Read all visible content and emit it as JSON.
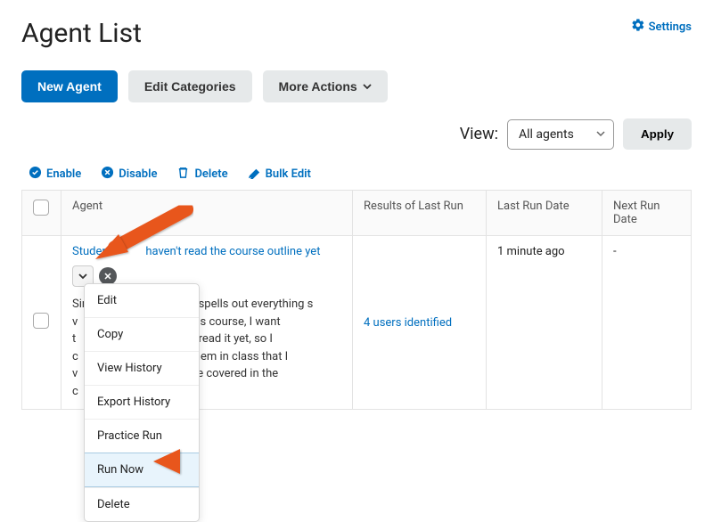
{
  "pageTitle": "Agent List",
  "settingsLabel": "Settings",
  "toolbar": {
    "newAgent": "New Agent",
    "editCategories": "Edit Categories",
    "moreActions": "More Actions"
  },
  "view": {
    "label": "View:",
    "selected": "All agents",
    "apply": "Apply"
  },
  "bulkActions": {
    "enable": "Enable",
    "disable": "Disable",
    "delete": "Delete",
    "bulkEdit": "Bulk Edit"
  },
  "columns": {
    "agent": "Agent",
    "results": "Results of Last Run",
    "lastRun": "Last Run Date",
    "nextRun": "Next Run Date"
  },
  "rows": [
    {
      "titlePart1": "Student",
      "titlePart2": "haven't read the course outline yet",
      "descPart1": "Since the course outline spells out everything s",
      "descPart2a": "ut this course, I want",
      "descPart2b": "t",
      "descPart3a": "ven't read it yet, so I",
      "descPart3b": "c",
      "descPart4a": "nd them in class that I",
      "descPart4b": "v",
      "descPart5a": "at are covered in the",
      "descPart5b": "c",
      "results": "4 users identified",
      "lastRun": "1 minute ago",
      "nextRun": "-"
    }
  ],
  "dropdown": {
    "edit": "Edit",
    "copy": "Copy",
    "viewHistory": "View History",
    "exportHistory": "Export History",
    "practiceRun": "Practice Run",
    "runNow": "Run Now",
    "delete": "Delete"
  }
}
